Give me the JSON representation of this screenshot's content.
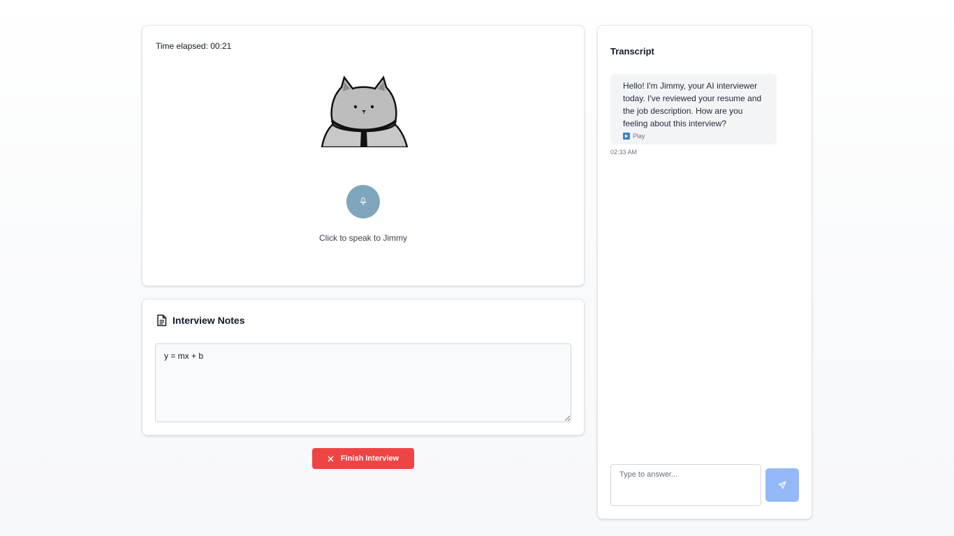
{
  "interview": {
    "timer_label": "Time elapsed: 00:21",
    "avatar_icon": "cat-interviewer-avatar",
    "mic_icon": "microphone-icon",
    "mic_color": "#7fa6bc",
    "mic_caption": "Click to speak to Jimmy"
  },
  "notes": {
    "icon": "document-icon",
    "title": "Interview Notes",
    "value": "y = mx + b"
  },
  "finish": {
    "label": "Finish Interview",
    "icon": "close-icon",
    "color": "#ef4444"
  },
  "transcript": {
    "title": "Transcript",
    "messages": [
      {
        "text": "Hello! I'm Jimmy, your AI interviewer today. I've reviewed your resume and the job description. How are you feeling about this interview?",
        "play_label": "Play",
        "time": "02:33 AM"
      }
    ],
    "input_placeholder": "Type to answer...",
    "send_icon": "send-icon",
    "send_color": "#93b9f9"
  }
}
